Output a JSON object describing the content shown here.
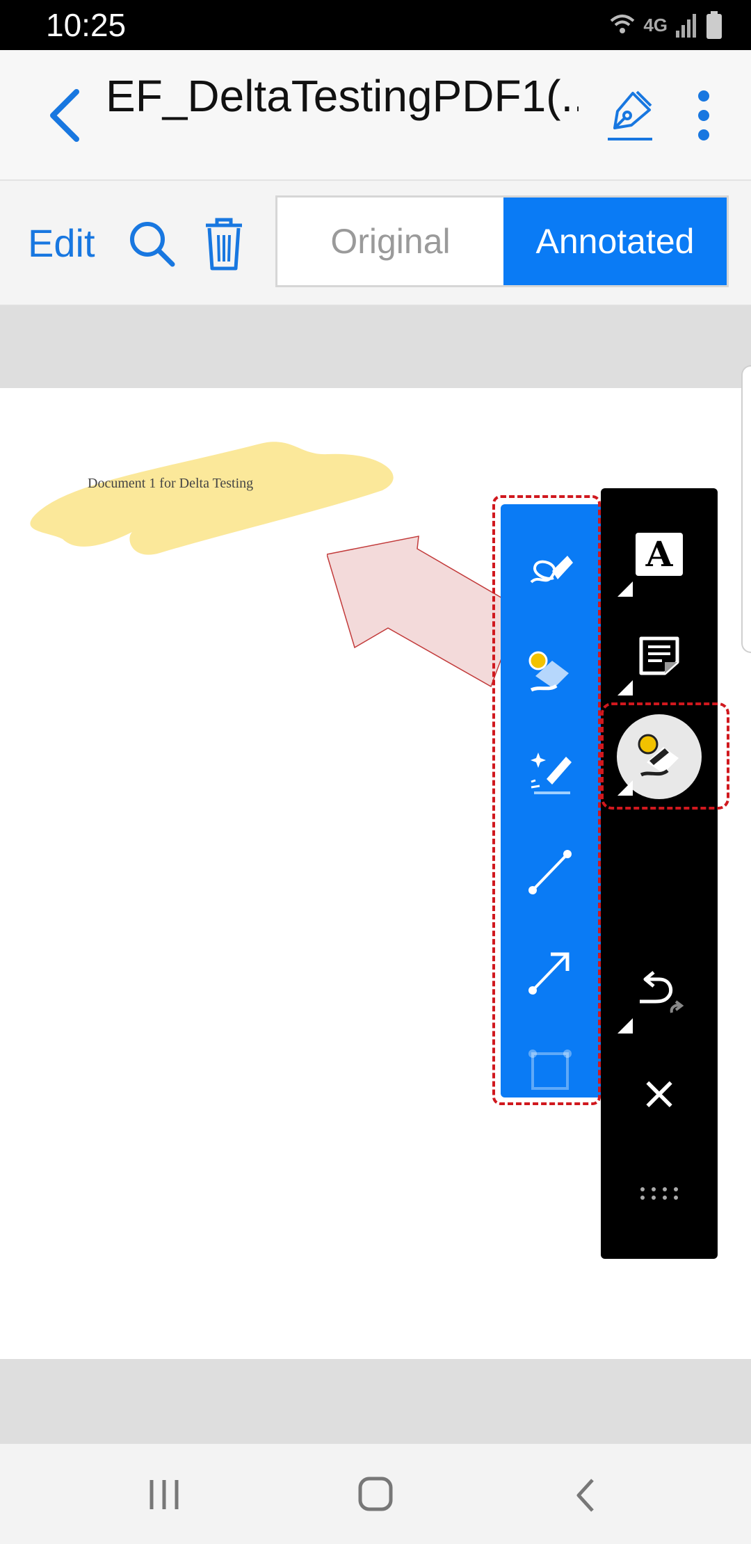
{
  "status_bar": {
    "time": "10:25",
    "network": "4G"
  },
  "app_bar": {
    "title": "EF_DeltaTestingPDF1(..."
  },
  "toolbar": {
    "edit_label": "Edit",
    "tab_original": "Original",
    "tab_annotated": "Annotated",
    "active_tab": "Annotated"
  },
  "document": {
    "text": "Document 1 for Delta Testing"
  },
  "annotation_tools": {
    "items": [
      "signature-pen",
      "highlighter",
      "magic-pen",
      "line",
      "arrow",
      "rectangle"
    ]
  },
  "main_tools": {
    "items": [
      "text",
      "note",
      "highlighter",
      "undo-redo",
      "close",
      "drag-handle"
    ],
    "text_glyph": "A",
    "close_glyph": "×"
  },
  "colors": {
    "accent": "#0a7bf5",
    "highlight": "#fbe89a",
    "arrow_fill": "#f3dada",
    "dash_red": "#d0181e"
  }
}
